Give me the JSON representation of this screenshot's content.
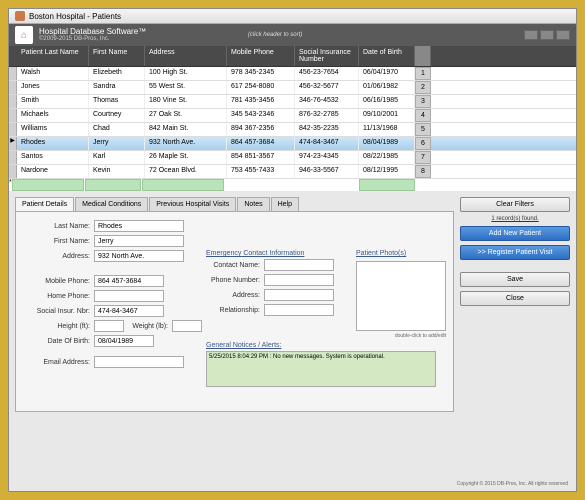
{
  "window": {
    "title": "Boston Hospital - Patients"
  },
  "header": {
    "app_name": "Hospital Database Software™",
    "copyright": "©2009-2015 DB-Pros, Inc.",
    "hint": "(click header to sort)"
  },
  "columns": {
    "last_name": "Patient Last Name",
    "first_name": "First Name",
    "address": "Address",
    "mobile": "Mobile Phone",
    "ssn": "Social Insurance Number",
    "dob": "Date of Birth"
  },
  "rows": [
    {
      "ln": "Walsh",
      "fn": "Elizebeth",
      "addr": "100 High St.",
      "ph": "978 345-2345",
      "ssn": "456-23-7654",
      "dob": "06/04/1970",
      "idx": "1"
    },
    {
      "ln": "Jones",
      "fn": "Sandra",
      "addr": "55 West St.",
      "ph": "617 254-8080",
      "ssn": "456-32-5677",
      "dob": "01/06/1982",
      "idx": "2"
    },
    {
      "ln": "Smith",
      "fn": "Thomas",
      "addr": "180 Vine St.",
      "ph": "781 435-3456",
      "ssn": "346-76-4532",
      "dob": "06/16/1985",
      "idx": "3"
    },
    {
      "ln": "Michaels",
      "fn": "Courtney",
      "addr": "27 Oak St.",
      "ph": "345 543-2346",
      "ssn": "876-32-2785",
      "dob": "09/10/2001",
      "idx": "4"
    },
    {
      "ln": "Williams",
      "fn": "Chad",
      "addr": "842 Main St.",
      "ph": "894 367-2356",
      "ssn": "842-35-2235",
      "dob": "11/13/1968",
      "idx": "5"
    },
    {
      "ln": "Rhodes",
      "fn": "Jerry",
      "addr": "932 North Ave.",
      "ph": "864 457-3684",
      "ssn": "474-84-3467",
      "dob": "08/04/1989",
      "idx": "6"
    },
    {
      "ln": "Santos",
      "fn": "Karl",
      "addr": "26 Maple St.",
      "ph": "854 851-3567",
      "ssn": "974-23-4345",
      "dob": "08/22/1985",
      "idx": "7"
    },
    {
      "ln": "Nardone",
      "fn": "Kevin",
      "addr": "72 Ocean Blvd.",
      "ph": "753 455-7433",
      "ssn": "946-33-5567",
      "dob": "08/12/1995",
      "idx": "8"
    }
  ],
  "selected_row_index": 5,
  "tabs": [
    "Patient Details",
    "Medical Conditions",
    "Previous Hospital Visits",
    "Notes",
    "Help"
  ],
  "form": {
    "labels": {
      "last_name": "Last Name:",
      "first_name": "First Name:",
      "address": "Address:",
      "mobile": "Mobile Phone:",
      "home": "Home Phone:",
      "ssn": "Social Insur. Nbr:",
      "height": "Height (ft):",
      "weight": "Weight (lb):",
      "dob": "Date Of Birth:",
      "email": "Email Address:"
    },
    "values": {
      "last_name": "Rhodes",
      "first_name": "Jerry",
      "address": "932 North Ave.",
      "mobile": "864 457-3684",
      "home": "",
      "ssn": "474-84-3467",
      "height": "",
      "weight": "",
      "dob": "08/04/1989",
      "email": ""
    }
  },
  "emergency": {
    "header": "Emergency Contact Information",
    "labels": {
      "name": "Contact Name:",
      "phone": "Phone Number:",
      "address": "Address:",
      "rel": "Relationship:"
    }
  },
  "photo": {
    "header": "Patient Photo(s)",
    "hint": "double-click to add/edit"
  },
  "alerts": {
    "header": "General Notices / Alerts:",
    "text": "5/25/2015 8:04:29 PM : No new messages. System is operational."
  },
  "buttons": {
    "clear_filters": "Clear Filters",
    "records_found": "1 record(s) found.",
    "add_patient": "Add New Patient",
    "register_visit": ">> Register Patient Visit",
    "save": "Save",
    "close": "Close"
  },
  "footer": "Copyright © 2015 DB-Pros, Inc. All rights reserved"
}
